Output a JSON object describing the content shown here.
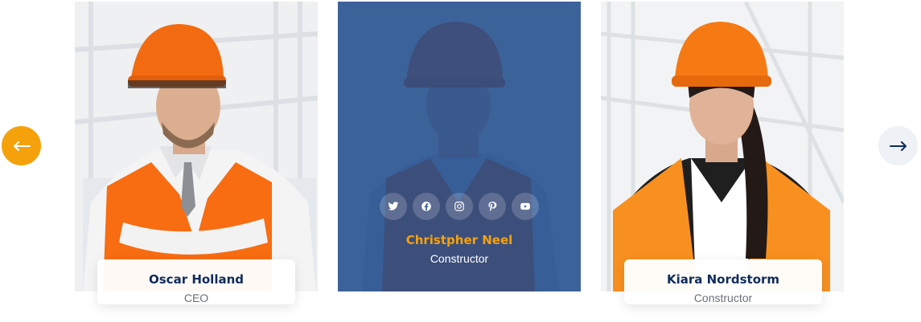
{
  "colors": {
    "accent": "#f5a10b",
    "navy": "#0f2c5c",
    "overlay": "#1f4b8c"
  },
  "carousel": {
    "prev_icon": "arrow-left-icon",
    "next_icon": "arrow-right-icon"
  },
  "team": [
    {
      "name": "Oscar Holland",
      "role": "CEO"
    },
    {
      "name": "Christpher Neel",
      "role": "Constructor",
      "social": [
        "twitter-icon",
        "facebook-icon",
        "instagram-icon",
        "pinterest-icon",
        "youtube-icon"
      ]
    },
    {
      "name": "Kiara Nordstorm",
      "role": "Constructor"
    }
  ]
}
